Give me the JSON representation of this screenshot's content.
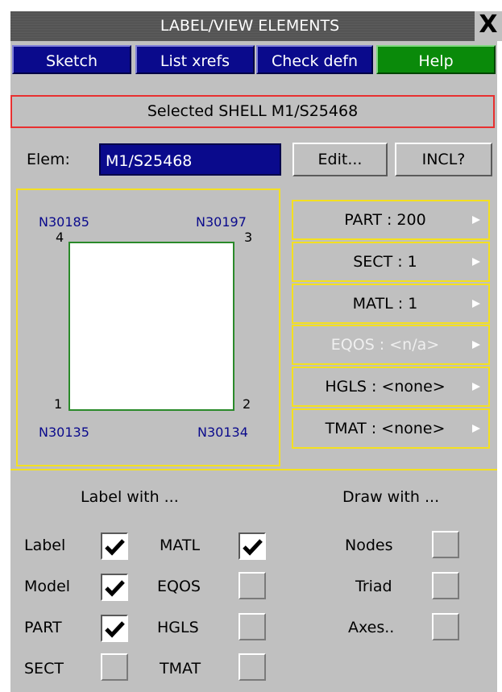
{
  "window": {
    "title": "LABEL/VIEW ELEMENTS",
    "close_glyph": "X"
  },
  "toolbar": {
    "sketch": "Sketch",
    "list_xrefs": "List xrefs",
    "check_defn": "Check defn",
    "help": "Help"
  },
  "selected_text": "Selected SHELL M1/S25468",
  "elem": {
    "label": "Elem:",
    "value": "M1/S25468",
    "edit": "Edit...",
    "incl": "INCL?"
  },
  "diagram": {
    "nodes": [
      {
        "id": "N30185",
        "num": "4"
      },
      {
        "id": "N30197",
        "num": "3"
      },
      {
        "id": "N30135",
        "num": "1"
      },
      {
        "id": "N30134",
        "num": "2"
      }
    ]
  },
  "props": [
    {
      "label": "PART  : 200",
      "enabled": true
    },
    {
      "label": "SECT  : 1",
      "enabled": true
    },
    {
      "label": "MATL  : 1",
      "enabled": true
    },
    {
      "label": "EQOS  : <n/a>",
      "enabled": false
    },
    {
      "label": "HGLS  : <none>",
      "enabled": true
    },
    {
      "label": "TMAT  : <none>",
      "enabled": true
    }
  ],
  "label_with": {
    "header": "Label with ...",
    "items": [
      {
        "label": "Label",
        "checked": true
      },
      {
        "label": "Model",
        "checked": true
      },
      {
        "label": "PART",
        "checked": true
      },
      {
        "label": "SECT",
        "checked": false
      },
      {
        "label": "MATL",
        "checked": true
      },
      {
        "label": "EQOS",
        "checked": false
      },
      {
        "label": "HGLS",
        "checked": false
      },
      {
        "label": "TMAT",
        "checked": false
      }
    ]
  },
  "draw_with": {
    "header": "Draw with ...",
    "items": [
      {
        "label": "Nodes",
        "checked": false
      },
      {
        "label": "Triad",
        "checked": false
      },
      {
        "label": "Axes..",
        "checked": false
      }
    ]
  },
  "colors": {
    "blue_button": "#0a0a8c",
    "help_green": "#0a8a0a",
    "highlight_yellow": "#f4e020",
    "selected_red": "#e83030",
    "panel_gray": "#c0c0c0"
  }
}
